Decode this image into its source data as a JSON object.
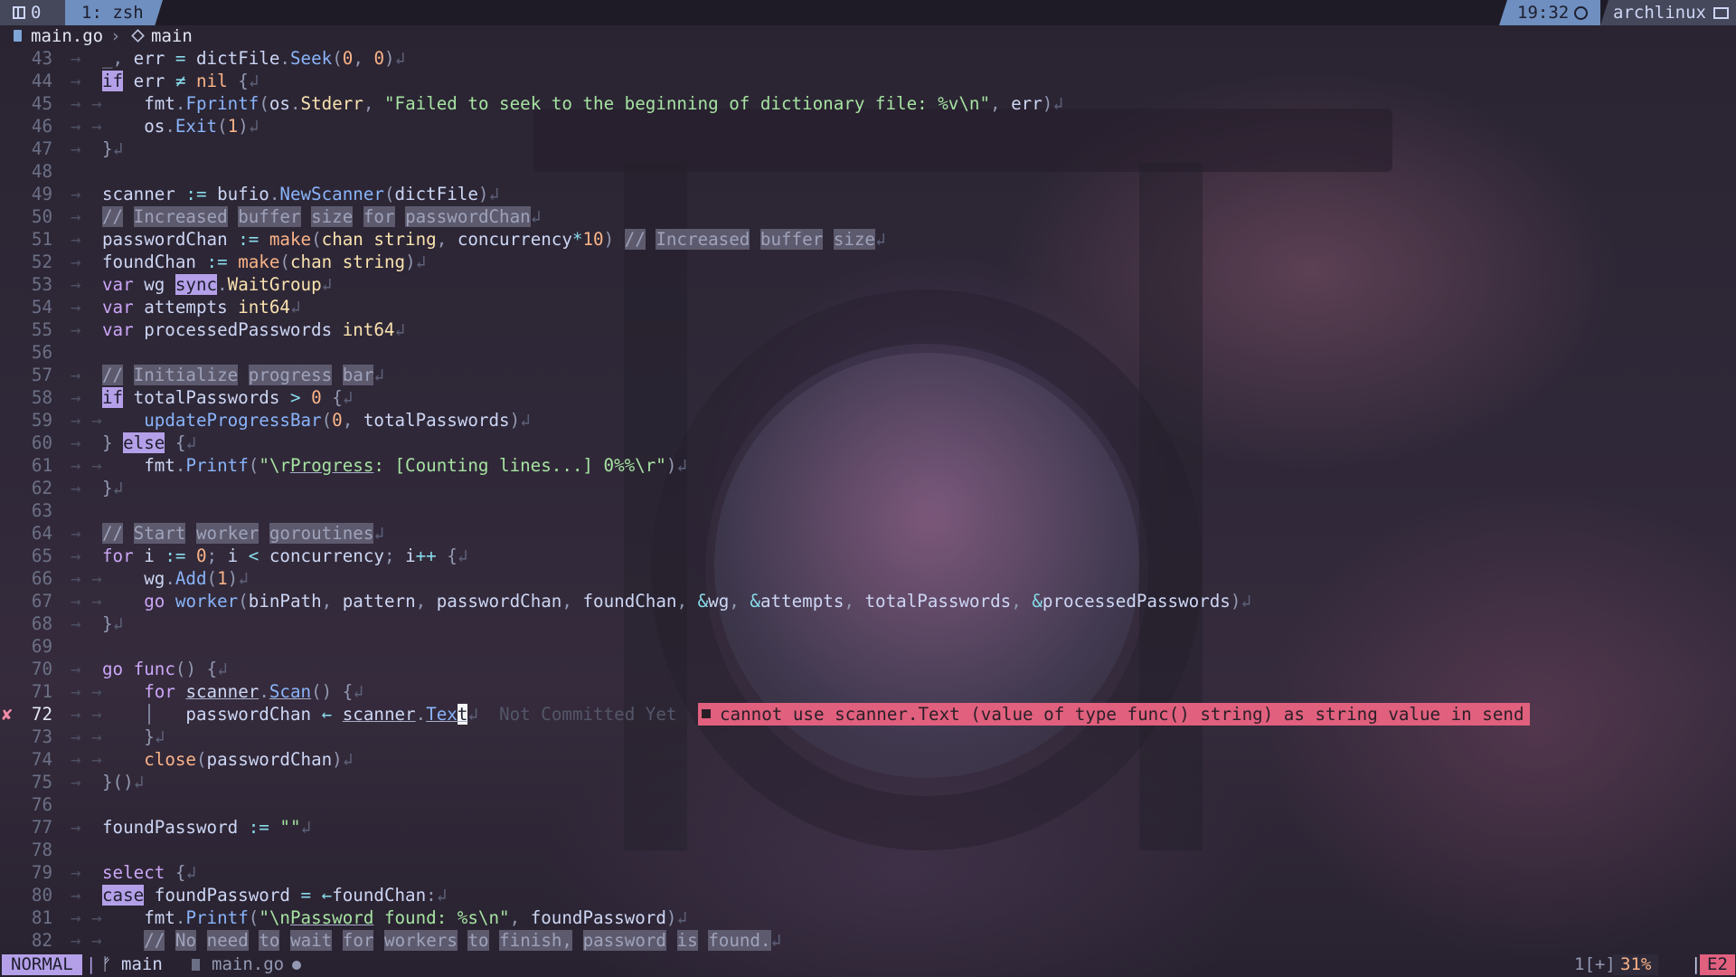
{
  "tmux": {
    "session": "0",
    "window": "1: zsh",
    "time": "19:32",
    "host": "archlinux",
    "icons": [
      "grid-icon",
      "clock-icon",
      "monitor-icon"
    ]
  },
  "breadcrumb": {
    "file": "main.go",
    "separator": "›",
    "symbol": "main",
    "icons": [
      "file-icon",
      "cube-icon"
    ]
  },
  "editor": {
    "cursor_line": 72,
    "lines": [
      {
        "num": "43",
        "indent": "→",
        "html": "<span class=\"p\">_,</span> err <span class=\"o\">=</span> dictFile<span class=\"p\">.</span><span class=\"f\">Seek</span><span class=\"p\">(</span><span class=\"n\">0</span><span class=\"p\">,</span> <span class=\"n\">0</span><span class=\"p\">)</span><span class=\"nl\">↲</span>"
      },
      {
        "num": "44",
        "indent": "→",
        "html": "<span class=\"hl\">if</span> err <span class=\"o\">≠</span> <span class=\"n\">nil</span> <span class=\"p\">{</span><span class=\"nl\">↲</span>"
      },
      {
        "num": "45",
        "indent": "→ →",
        "html": "    fmt<span class=\"p\">.</span><span class=\"f\">Fprintf</span><span class=\"p\">(</span>os<span class=\"p\">.</span><span class=\"t\">Stderr</span><span class=\"p\">,</span> <span class=\"s\">\"Failed to seek to the beginning of dictionary file: %v\\n\"</span><span class=\"p\">,</span> err<span class=\"p\">)</span><span class=\"nl\">↲</span>"
      },
      {
        "num": "46",
        "indent": "→ →",
        "html": "    os<span class=\"p\">.</span><span class=\"f\">Exit</span><span class=\"p\">(</span><span class=\"n\">1</span><span class=\"p\">)</span><span class=\"nl\">↲</span>"
      },
      {
        "num": "47",
        "indent": "→",
        "html": "<span class=\"p\">}</span><span class=\"nl\">↲</span>"
      },
      {
        "num": "48",
        "indent": "",
        "html": ""
      },
      {
        "num": "49",
        "indent": "→",
        "html": "scanner <span class=\"o\">:=</span> bufio<span class=\"p\">.</span><span class=\"f\">NewScanner</span><span class=\"p\">(</span>dictFile<span class=\"p\">)</span><span class=\"nl\">↲</span>"
      },
      {
        "num": "50",
        "indent": "→",
        "html": "<span class=\"cm\">//</span> <span class=\"cm\">Increased</span> <span class=\"cm\">buffer</span> <span class=\"cm\">size</span> <span class=\"cm\">for</span> <span class=\"cm\">passwordChan</span><span class=\"nl\">↲</span>"
      },
      {
        "num": "51",
        "indent": "→",
        "html": "passwordChan <span class=\"o\">:=</span> <span class=\"n\">make</span><span class=\"p\">(</span><span class=\"t\">chan string</span><span class=\"p\">,</span> concurrency<span class=\"o\">*</span><span class=\"n\">10</span><span class=\"p\">)</span> <span class=\"cm\">//</span> <span class=\"cm\">Increased</span> <span class=\"cm\">buffer</span> <span class=\"cm\">size</span><span class=\"nl\">↲</span>"
      },
      {
        "num": "52",
        "indent": "→",
        "html": "foundChan <span class=\"o\">:=</span> <span class=\"n\">make</span><span class=\"p\">(</span><span class=\"t\">chan string</span><span class=\"p\">)</span><span class=\"nl\">↲</span>"
      },
      {
        "num": "53",
        "indent": "→",
        "html": "<span class=\"k\">var</span> wg <span class=\"hl\">sync</span><span class=\"p\">.</span><span class=\"t\">WaitGroup</span><span class=\"nl\">↲</span>"
      },
      {
        "num": "54",
        "indent": "→",
        "html": "<span class=\"k\">var</span> attempts <span class=\"t\">int64</span><span class=\"nl\">↲</span>"
      },
      {
        "num": "55",
        "indent": "→",
        "html": "<span class=\"k\">var</span> processedPasswords <span class=\"t\">int64</span><span class=\"nl\">↲</span>"
      },
      {
        "num": "56",
        "indent": "",
        "html": ""
      },
      {
        "num": "57",
        "indent": "→",
        "html": "<span class=\"cm\">//</span> <span class=\"cm\">Initialize</span> <span class=\"cm\">progress</span> <span class=\"cm\">bar</span><span class=\"nl\">↲</span>"
      },
      {
        "num": "58",
        "indent": "→",
        "html": "<span class=\"hl\">if</span> totalPasswords <span class=\"o\">&gt;</span> <span class=\"n\">0</span> <span class=\"p\">{</span><span class=\"nl\">↲</span>"
      },
      {
        "num": "59",
        "indent": "→ →",
        "html": "    <span class=\"f\">updateProgressBar</span><span class=\"p\">(</span><span class=\"n\">0</span><span class=\"p\">,</span> totalPasswords<span class=\"p\">)</span><span class=\"nl\">↲</span>"
      },
      {
        "num": "60",
        "indent": "→",
        "html": "<span class=\"p\">}</span> <span class=\"hl\">else</span> <span class=\"p\">{</span><span class=\"nl\">↲</span>"
      },
      {
        "num": "61",
        "indent": "→ →",
        "html": "    fmt<span class=\"p\">.</span><span class=\"f\">Printf</span><span class=\"p\">(</span><span class=\"s\">\"\\r<span class=\"u\">Progress</span>: [Counting lines...] 0%%\\r\"</span><span class=\"p\">)</span><span class=\"nl\">↲</span>"
      },
      {
        "num": "62",
        "indent": "→",
        "html": "<span class=\"p\">}</span><span class=\"nl\">↲</span>"
      },
      {
        "num": "63",
        "indent": "",
        "html": ""
      },
      {
        "num": "64",
        "indent": "→",
        "html": "<span class=\"cm\">//</span> <span class=\"cm\">Start</span> <span class=\"cm\">worker</span> <span class=\"cm\">goroutines</span><span class=\"nl\">↲</span>"
      },
      {
        "num": "65",
        "indent": "→",
        "html": "<span class=\"k\">for</span> i <span class=\"o\">:=</span> <span class=\"n\">0</span><span class=\"p\">;</span> i <span class=\"o\">&lt;</span> concurrency<span class=\"p\">;</span> i<span class=\"o\">++</span> <span class=\"p\">{</span><span class=\"nl\">↲</span>"
      },
      {
        "num": "66",
        "indent": "→ →",
        "html": "    wg<span class=\"p\">.</span><span class=\"f\">Add</span><span class=\"p\">(</span><span class=\"n\">1</span><span class=\"p\">)</span><span class=\"nl\">↲</span>"
      },
      {
        "num": "67",
        "indent": "→ →",
        "html": "    <span class=\"k\">go</span> <span class=\"f\">worker</span><span class=\"p\">(</span>binPath<span class=\"p\">,</span> pattern<span class=\"p\">,</span> passwordChan<span class=\"p\">,</span> foundChan<span class=\"p\">,</span> <span class=\"o\">&amp;</span>wg<span class=\"p\">,</span> <span class=\"o\">&amp;</span>attempts<span class=\"p\">,</span> totalPasswords<span class=\"p\">,</span> <span class=\"o\">&amp;</span>processedPasswords<span class=\"p\">)</span><span class=\"nl\">↲</span>"
      },
      {
        "num": "68",
        "indent": "→",
        "html": "<span class=\"p\">}</span><span class=\"nl\">↲</span>"
      },
      {
        "num": "69",
        "indent": "",
        "html": ""
      },
      {
        "num": "70",
        "indent": "→",
        "html": "<span class=\"k\">go</span> <span class=\"k\">func</span><span class=\"p\">()</span> <span class=\"p\">{</span><span class=\"nl\">↲</span>"
      },
      {
        "num": "71",
        "indent": "→ →",
        "html": "    <span class=\"k\">for</span> <span class=\"u\">scanner</span><span class=\"p\">.</span><span class=\"f u\">Scan</span><span class=\"p\">()</span> <span class=\"p\">{</span><span class=\"nl\">↲</span>"
      },
      {
        "num": "72",
        "indent": "→ →",
        "sign": "✘",
        "html": "    <span class=\"p\">│</span>   passwordChan <span class=\"o\">←</span> <span class=\"u\">scanner</span><span class=\"p\">.</span><span class=\"f u\">Tex</span><span class=\"cursor u\">t</span><span class=\"nl\">↲</span>  <span class=\"blame\">Not Committed Yet</span>"
      },
      {
        "num": "73",
        "indent": "→ →",
        "html": "    <span class=\"p\">}</span><span class=\"nl\">↲</span>"
      },
      {
        "num": "74",
        "indent": "→ →",
        "html": "    <span class=\"n\">close</span><span class=\"p\">(</span>passwordChan<span class=\"p\">)</span><span class=\"nl\">↲</span>"
      },
      {
        "num": "75",
        "indent": "→",
        "html": "<span class=\"p\">}()</span><span class=\"nl\">↲</span>"
      },
      {
        "num": "76",
        "indent": "",
        "html": ""
      },
      {
        "num": "77",
        "indent": "→",
        "html": "foundPassword <span class=\"o\">:=</span> <span class=\"s\">\"\"</span><span class=\"nl\">↲</span>"
      },
      {
        "num": "78",
        "indent": "",
        "html": ""
      },
      {
        "num": "79",
        "indent": "→",
        "html": "<span class=\"k\">select</span> <span class=\"p\">{</span><span class=\"nl\">↲</span>"
      },
      {
        "num": "80",
        "indent": "→",
        "html": "<span class=\"hl\">case</span> foundPassword <span class=\"o\">=</span> <span class=\"o\">←</span>foundChan<span class=\"p\">:</span><span class=\"nl\">↲</span>"
      },
      {
        "num": "81",
        "indent": "→ →",
        "html": "    fmt<span class=\"p\">.</span><span class=\"f\">Printf</span><span class=\"p\">(</span><span class=\"s\">\"\\n<span class=\"u\">Password</span> found: %s\\n\"</span><span class=\"p\">,</span> foundPassword<span class=\"p\">)</span><span class=\"nl\">↲</span>"
      },
      {
        "num": "82",
        "indent": "→ →",
        "html": "    <span class=\"cm\">//</span> <span class=\"cm\">No</span> <span class=\"cm\">need</span> <span class=\"cm\">to</span> <span class=\"cm\">wait</span> <span class=\"cm\">for</span> <span class=\"cm\">workers</span> <span class=\"cm\">to</span> <span class=\"cm\">finish,</span> <span class=\"cm\">password</span> <span class=\"cm\">is</span> <span class=\"cm\">found.</span><span class=\"nl\">↲</span>"
      }
    ],
    "diagnostic": {
      "line": "72",
      "message": "cannot use scanner.Text (value of type func() string) as string value in send",
      "severity_color": "#e0607e"
    }
  },
  "statusline": {
    "mode": "NORMAL",
    "branch": "main",
    "file": "main.go",
    "buffer": "1[+]",
    "percent": "31%",
    "errors": "E2",
    "icons": [
      "branch-icon",
      "file-icon",
      "modified-dot-icon"
    ]
  }
}
